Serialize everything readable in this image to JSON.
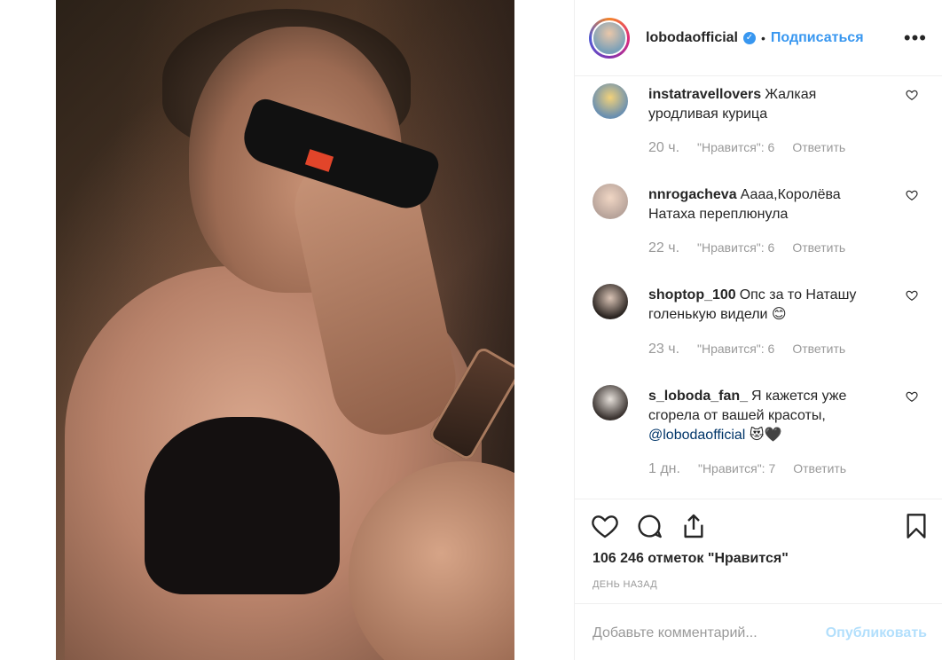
{
  "header": {
    "username": "lobodaofficial",
    "separator": "•",
    "follow_label": "Подписаться",
    "more_label": "•••"
  },
  "comments": [
    {
      "username": "instatravellovers",
      "text": "Жалкая уродливая курица",
      "time": "20 ч.",
      "likes": "\"Нравится\": 6",
      "reply": "Ответить"
    },
    {
      "username": "nnrogacheva",
      "text": "Аааа,Королёва Натаха переплюнула",
      "time": "22 ч.",
      "likes": "\"Нравится\": 6",
      "reply": "Ответить"
    },
    {
      "username": "shoptop_100",
      "text": "Опс за то Наташу голенькую видели 😊",
      "time": "23 ч.",
      "likes": "\"Нравится\": 6",
      "reply": "Ответить"
    },
    {
      "username": "s_loboda_fan_",
      "text": "Я кажется уже сгорела от вашей красоты,",
      "mention": "@lobodaofficial",
      "emoji": "😻🖤",
      "time": "1 дн.",
      "likes": "\"Нравится\": 7",
      "reply": "Ответить"
    }
  ],
  "post": {
    "likes_text": "106 246 отметок \"Нравится\"",
    "date_text": "ДЕНЬ НАЗАД"
  },
  "composer": {
    "placeholder": "Добавьте комментарий...",
    "publish_label": "Опубликовать"
  },
  "colors": {
    "link": "#3897f0",
    "mention": "#003569",
    "muted": "#999999",
    "publish_disabled": "#b2dffc"
  }
}
